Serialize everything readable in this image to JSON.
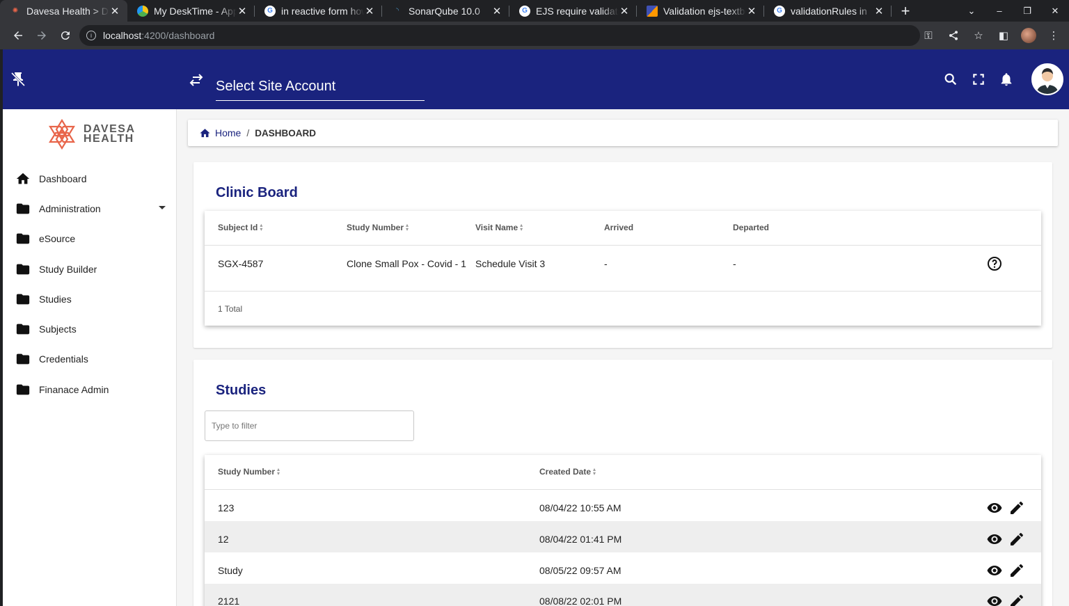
{
  "browser": {
    "tabs": [
      {
        "title": "Davesa Health > Dashboard",
        "active": true
      },
      {
        "title": "My DeskTime - Application",
        "active": false
      },
      {
        "title": "in reactive form how",
        "active": false
      },
      {
        "title": "SonarQube 10.0",
        "active": false
      },
      {
        "title": "EJS require validation",
        "active": false
      },
      {
        "title": "Validation ejs-textbox",
        "active": false
      },
      {
        "title": "validationRules in",
        "active": false
      }
    ],
    "url_host": "localhost",
    "url_path": ":4200/dashboard"
  },
  "header": {
    "site_select_placeholder": "Select Site Account"
  },
  "logo": {
    "line1": "DAVESA",
    "line2": "HEALTH"
  },
  "sidebar": {
    "items": [
      {
        "label": "Dashboard",
        "icon": "home-icon"
      },
      {
        "label": "Administration",
        "icon": "folder-icon",
        "expandable": true
      },
      {
        "label": "eSource",
        "icon": "folder-icon"
      },
      {
        "label": "Study Builder",
        "icon": "folder-icon"
      },
      {
        "label": "Studies",
        "icon": "folder-icon"
      },
      {
        "label": "Subjects",
        "icon": "folder-icon"
      },
      {
        "label": "Credentials",
        "icon": "folder-icon"
      },
      {
        "label": "Finanace Admin",
        "icon": "folder-icon"
      }
    ]
  },
  "breadcrumb": {
    "home": "Home",
    "separator": "/",
    "current": "DASHBOARD"
  },
  "clinic_board": {
    "title": "Clinic Board",
    "columns": [
      "Subject Id",
      "Study Number",
      "Visit Name",
      "Arrived",
      "Departed"
    ],
    "rows": [
      {
        "subject_id": "SGX-4587",
        "study_number": "Clone Small Pox - Covid - 1",
        "visit_name": "Schedule Visit 3",
        "arrived": "-",
        "departed": "-"
      }
    ],
    "footer": "1 Total"
  },
  "studies": {
    "title": "Studies",
    "filter_placeholder": "Type to filter",
    "columns": [
      "Study Number",
      "Created Date"
    ],
    "rows": [
      {
        "study_number": "123",
        "created_date": "08/04/22 10:55 AM"
      },
      {
        "study_number": "12",
        "created_date": "08/04/22 01:41 PM"
      },
      {
        "study_number": "Study",
        "created_date": "08/05/22 09:57 AM"
      },
      {
        "study_number": "2121",
        "created_date": "08/08/22 02:01 PM"
      }
    ]
  },
  "colors": {
    "primary": "#1a237e",
    "logo": "#e8654a"
  }
}
